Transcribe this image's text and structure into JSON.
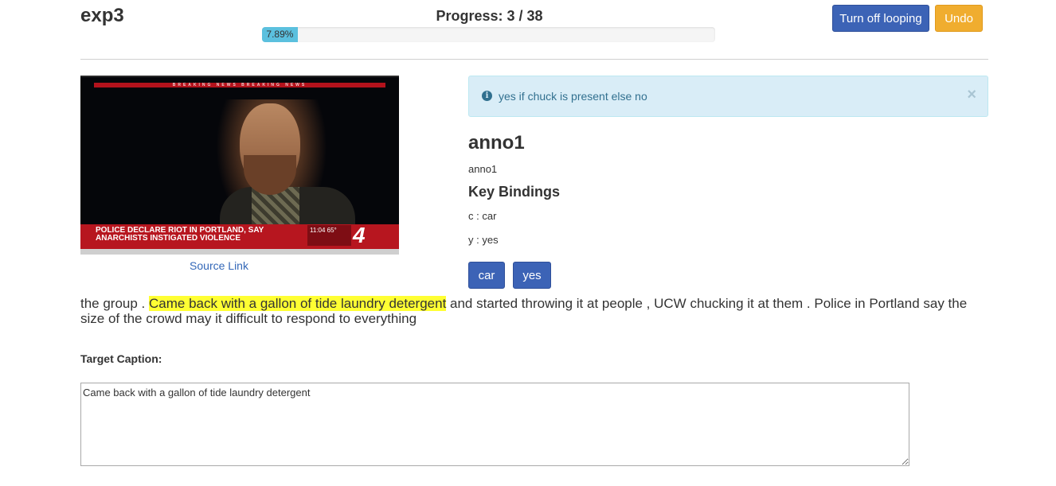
{
  "header": {
    "app_title": "exp3",
    "progress_label": "Progress: 3 / 38",
    "progress_percent_text": "7.89%",
    "progress_fraction": 0.0789,
    "looping_button": "Turn off looping",
    "undo_button": "Undo"
  },
  "media": {
    "breaking_banner": "BREAKING NEWS  BREAKING NEWS",
    "lower_third": "POLICE DECLARE RIOT IN PORTLAND, SAY ANARCHISTS INSTIGATED VIOLENCE",
    "clock_text": "11:04  65°",
    "logo_text": "4",
    "source_link": "Source Link"
  },
  "alert": {
    "icon": "info-circle-icon",
    "text": "yes if chuck is present else no",
    "close": "×"
  },
  "annotation": {
    "title": "anno1",
    "subtitle": "anno1",
    "key_bindings_title": "Key Bindings",
    "key_bindings": [
      "c : car",
      "y : yes"
    ],
    "buttons": [
      "car",
      "yes"
    ]
  },
  "transcript": {
    "before": "the group . ",
    "highlight": "Came back with a gallon of tide laundry detergent",
    "after": " and started throwing it at people , UCW chucking it at them . Police in Portland say the size of the crowd may it difficult to respond to everything"
  },
  "target": {
    "label": "Target Caption:",
    "value": "Came back with a gallon of tide laundry detergent"
  },
  "colors": {
    "primary": "#3c63b6",
    "warning": "#f0ad2f",
    "progress": "#5bc0de",
    "highlight": "#ffff33",
    "alert_bg": "#d9edf7",
    "link": "#3468b8"
  }
}
